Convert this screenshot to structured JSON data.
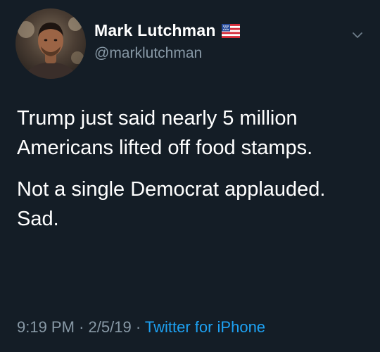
{
  "tweet": {
    "display_name": "Mark Lutchman",
    "handle": "@marklutchman",
    "flag_icon": "us-flag-icon",
    "caret_icon": "chevron-down-icon",
    "paragraphs": [
      "Trump just said nearly 5 million Americans lifted off food stamps.",
      "Not a single Democrat applauded. Sad."
    ],
    "time": "9:19 PM",
    "separator": "·",
    "date": "2/5/19",
    "source": "Twitter for iPhone"
  },
  "colors": {
    "background": "#141d26",
    "text": "#ffffff",
    "secondary_text": "#8899a6",
    "link": "#1da1f2"
  }
}
